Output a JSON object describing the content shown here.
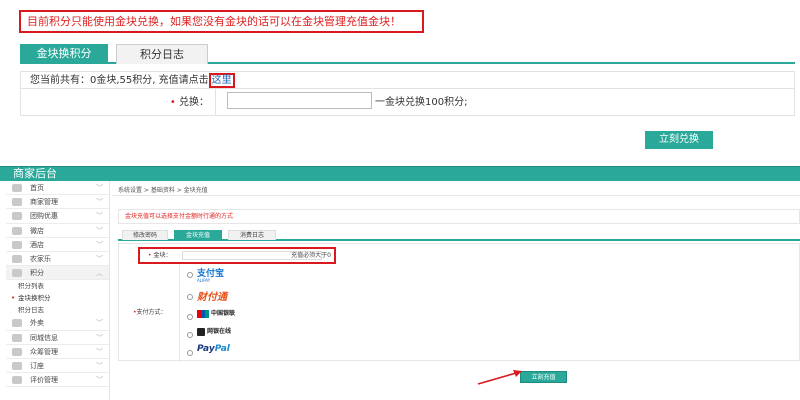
{
  "top": {
    "notice": "目前积分只能使用金块兑换，如果您没有金块的话可以在金块管理充值金块！",
    "tabs": [
      "金块换积分",
      "积分日志"
    ],
    "balance_text": "您当前共有：0金块,55积分, 充值请点击",
    "here_link": "这里",
    "exchange_label": "兑换：",
    "exchange_input": "",
    "exchange_hint": "一金块兑换100积分;",
    "exchange_button": "立刻兑换"
  },
  "admin": {
    "header_title": "商家后台",
    "sidebar": [
      {
        "label": "首页",
        "icon": "home-icon"
      },
      {
        "label": "商家管理",
        "icon": "user-icon"
      },
      {
        "label": "团购优惠",
        "icon": "group-buy-icon"
      },
      {
        "label": "微店",
        "icon": "star-icon"
      },
      {
        "label": "酒店",
        "icon": "hotel-icon"
      },
      {
        "label": "农家乐",
        "icon": "farm-icon"
      },
      {
        "label": "积分",
        "icon": "points-icon"
      }
    ],
    "sub_items": [
      "积分列表",
      "金块换积分",
      "积分日志"
    ],
    "sidebar_bottom": [
      {
        "label": "外卖",
        "icon": "takeout-icon"
      },
      {
        "label": "同城信息",
        "icon": "info-icon"
      },
      {
        "label": "众筹管理",
        "icon": "crowdfund-icon"
      },
      {
        "label": "订座",
        "icon": "reservation-icon"
      },
      {
        "label": "评价管理",
        "icon": "review-icon"
      }
    ],
    "breadcrumb": "系统设置 > 基础资料 > 金块充值",
    "notice": "金块充值可以选择支付金额时行通的方式",
    "tabs": [
      "修改密码",
      "金块充值",
      "消费日志"
    ],
    "gold_label": "金块：",
    "gold_input": "",
    "gold_hint": "充值必须大于0",
    "pay_label": "支付方式：",
    "pay_methods": {
      "alipay": "支付宝",
      "alipay_sub": "ALIPAY",
      "tenpay": "财付通",
      "unionpay": "中国银联",
      "netbank": "网银在线",
      "paypal_1": "Pay",
      "paypal_2": "Pal"
    },
    "recharge_button": "立刻充值"
  },
  "colors": {
    "accent": "#2aa99b",
    "highlight": "#d9191d",
    "notice_text": "#e02020"
  }
}
